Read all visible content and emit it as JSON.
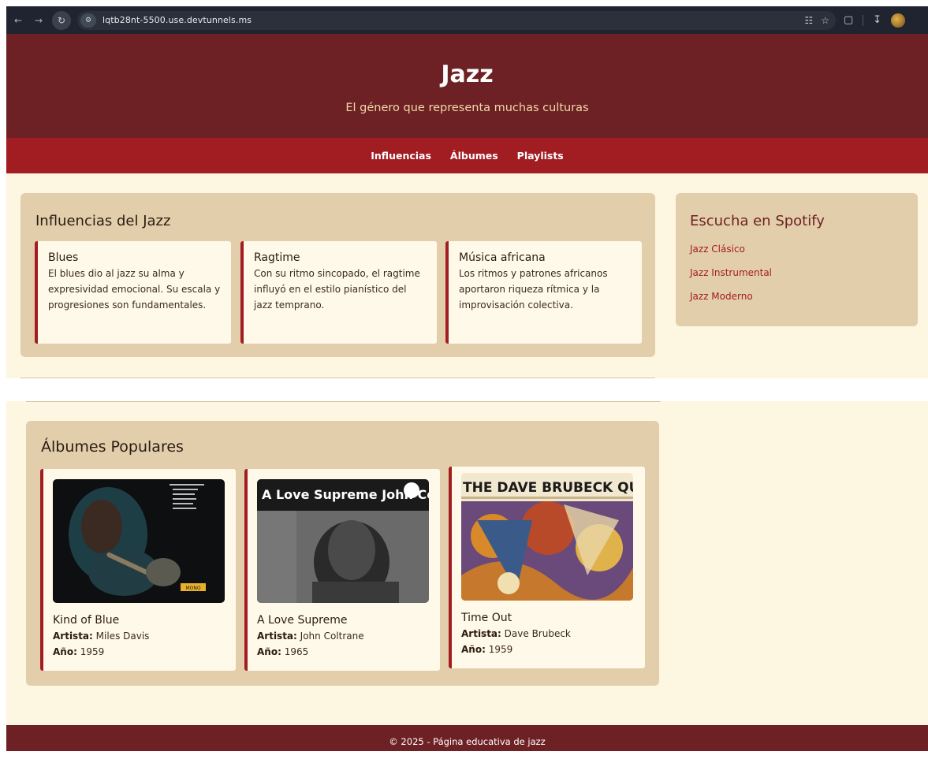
{
  "browser": {
    "url": "lqtb28nt-5500.use.devtunnels.ms"
  },
  "header": {
    "title": "Jazz",
    "subtitle": "El género que representa muchas culturas"
  },
  "nav": {
    "items": [
      "Influencias",
      "Álbumes",
      "Playlists"
    ]
  },
  "influences": {
    "title": "Influencias del Jazz",
    "cards": [
      {
        "title": "Blues",
        "text": "El blues dio al jazz su alma y expresividad emocional. Su escala y progresiones son fundamentales."
      },
      {
        "title": "Ragtime",
        "text": "Con su ritmo sincopado, el ragtime influyó en el estilo pianístico del jazz temprano."
      },
      {
        "title": "Música africana",
        "text": "Los ritmos y patrones africanos aportaron riqueza rítmica y la improvisación colectiva."
      }
    ]
  },
  "spotify": {
    "title": "Escucha en Spotify",
    "links": [
      "Jazz Clásico",
      "Jazz Instrumental",
      "Jazz Moderno"
    ]
  },
  "albums": {
    "title": "Álbumes Populares",
    "artist_label": "Artista:",
    "year_label": "Año:",
    "items": [
      {
        "title": "Kind of Blue",
        "artist": "Miles Davis",
        "year": "1959",
        "cover_text": "MONO"
      },
      {
        "title": "A Love Supreme",
        "artist": "John Coltrane",
        "year": "1965",
        "cover_text": "A Love Supreme John Coltrane"
      },
      {
        "title": "Time Out",
        "artist": "Dave Brubeck",
        "year": "1959",
        "cover_text": "THE DAVE BRUBECK QUARTET"
      }
    ]
  },
  "footer": {
    "text": "© 2025 - Página educativa de jazz"
  }
}
